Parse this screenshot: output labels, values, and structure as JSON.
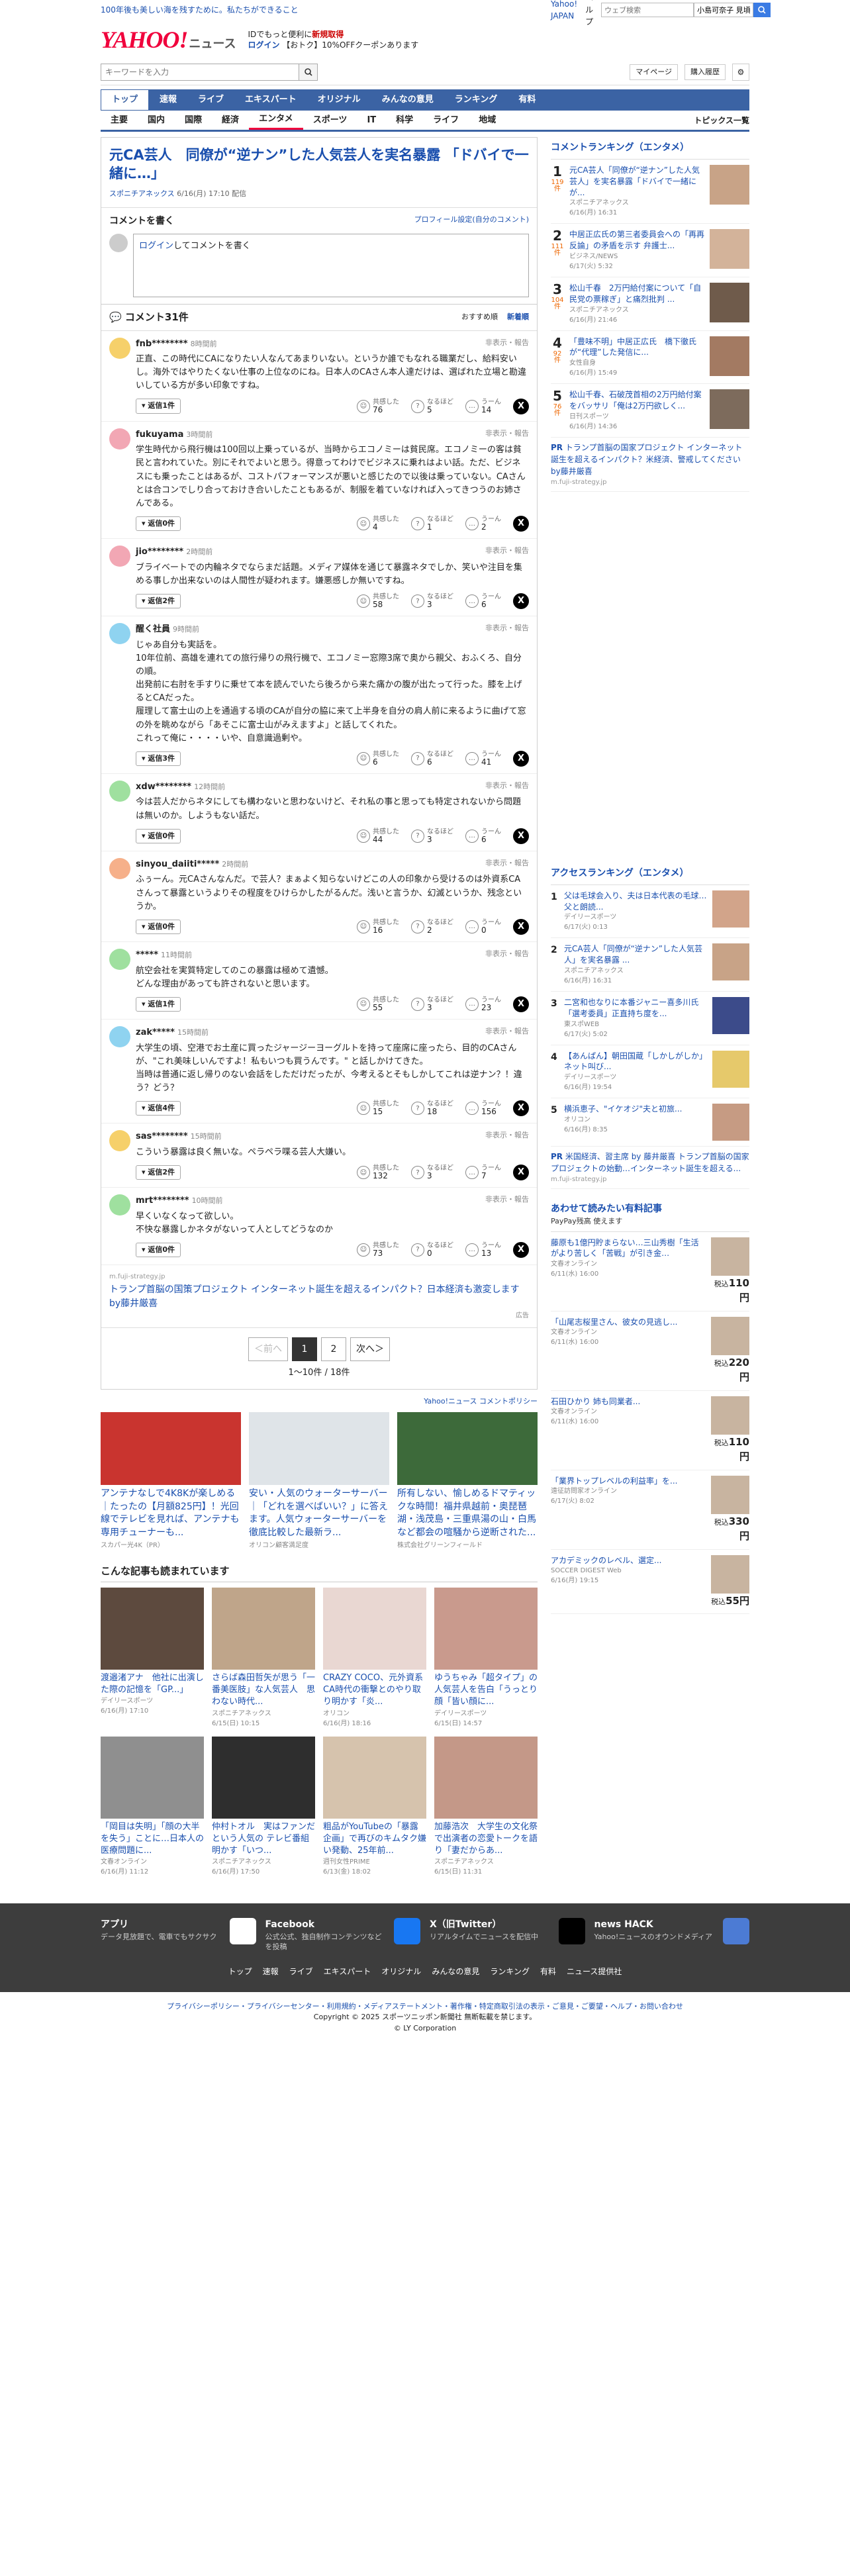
{
  "topbar": {
    "notice": "100年後も美しい海を残すために。私たちができること",
    "yahoo_japan": "Yahoo! JAPAN",
    "help": "ヘルプ",
    "search_placeholder": "ウェブ検索",
    "user": "小島可奈子 見頃"
  },
  "header": {
    "logo": "YAHOO!",
    "logo_sub": "ニュース",
    "promo1": "IDでもっと便利に",
    "promo1b": "新規取得",
    "promo2": "ログイン",
    "promo3": "【おトク】10%OFFクーポンあります"
  },
  "search": {
    "placeholder": "キーワードを入力",
    "mypage": "マイページ",
    "history": "購入履歴"
  },
  "nav": [
    "トップ",
    "速報",
    "ライブ",
    "エキスパート",
    "オリジナル",
    "みんなの意見",
    "ランキング",
    "有料"
  ],
  "subnav": [
    "主要",
    "国内",
    "国際",
    "経済",
    "エンタメ",
    "スポーツ",
    "IT",
    "科学",
    "ライフ",
    "地域"
  ],
  "subnav_right": "トピックス一覧",
  "article": {
    "title": "元CA芸人　同僚が“逆ナン”した人気芸人を実名暴露 「ドバイで一緒に…」",
    "source": "スポニチアネックス",
    "date": "6/16(月) 17:10 配信"
  },
  "comment_write": {
    "title": "コメントを書く",
    "profile": "プロフィール設定(自分のコメント)",
    "login": "ログイン",
    "placeholder": "してコメントを書く"
  },
  "comments_head": {
    "title": "コメント31件",
    "sort1": "おすすめ順",
    "sort2": "新着順"
  },
  "comments": [
    {
      "user": "fnb********",
      "time": "8時間前",
      "color": "#f6d06a",
      "text": "正直、この時代にCAになりたい人なんてあまりいない。というか誰でもなれる職業だし、給料安いし。海外ではやりたくない仕事の上位なのにね。日本人のCAさん本人達だけは、選ばれた立場と勘違いしている方が多い印象ですね。",
      "replies": "返信1件",
      "r1": "76",
      "r2": "5",
      "r3": "14"
    },
    {
      "user": "fukuyama",
      "time": "3時間前",
      "color": "#f2a7b4",
      "text": "学生時代から飛行機は100回以上乗っているが、当時からエコノミーは貧民席。エコノミーの客は貧民と言われていた。別にそれでよいと思う。得意ってわけでビジネスに乗れはよい話。ただ、ビジネスにも乗ったことはあるが、コストパフォーマンスが悪いと感じたので以後は乗っていない。CAさんとは合コンでしり合っておけき合いしたこともあるが、制服を着ていなければ入ってきつうのお姉さんである。",
      "replies": "返信0件",
      "r1": "4",
      "r2": "1",
      "r3": "2"
    },
    {
      "user": "jio********",
      "time": "2時間前",
      "color": "#f2a7b4",
      "text": "ブライベートでの内輪ネタでならまだ話題。メディア媒体を通じて暴露ネタでしか、笑いや注目を集める事しか出来ないのは人間性が疑われます。嫌悪感しか無いですね。",
      "replies": "返信2件",
      "r1": "58",
      "r2": "3",
      "r3": "6"
    },
    {
      "user": "醒く社員",
      "time": "9時間前",
      "color": "#8fd3f0",
      "text": "じゃあ自分も実話を。\n10年位前、高雄を連れての旅行帰りの飛行機で、エコノミー窓際3席で奥から親父、おふくろ、自分の順。\n出発前に右肘を手すりに乗せて本を読んでいたら後ろから来た痛かの腹が出たって行った。膝を上げるとCAだった。\n履理して富士山の上を通過する頃のCAが自分の脇に来て上半身を自分の肩人前に来るように曲げて窓の外を眺めながら「あそこに富士山がみえますよ」と話してくれた。\nこれって俺に・・・・いや、自意識過剰や。",
      "replies": "返信3件",
      "r1": "6",
      "r2": "6",
      "r3": "41"
    },
    {
      "user": "xdw********",
      "time": "12時間前",
      "color": "#9fe09f",
      "text": "今は芸人だからネタにしても構わないと思わないけど、それ私の事と思っても特定されないから問題は無いのか。しようもない話だ。",
      "replies": "返信0件",
      "r1": "44",
      "r2": "3",
      "r3": "6"
    },
    {
      "user": "sinyou_daiiti*****",
      "time": "2時間前",
      "color": "#f6b08a",
      "text": "ふぅーん。元CAさんなんだ。で芸人？まぁよく知らないけどこの人の印象から受けるのは外資系CAさんって暴露というよりその程度をひけらかしたがるんだ。浅いと言うか、幻滅というか、残念というか。",
      "replies": "返信0件",
      "r1": "16",
      "r2": "2",
      "r3": "0"
    },
    {
      "user": "*****",
      "time": "11時間前",
      "color": "#9fe09f",
      "text": "航空会社を実質特定してのこの暴露は極めて遺憾。\nどんな理由があっても許されないと思います。",
      "replies": "返信1件",
      "r1": "55",
      "r2": "3",
      "r3": "23"
    },
    {
      "user": "zak*****",
      "time": "15時間前",
      "color": "#8fd3f0",
      "text": "大学生の頃、空港でお土産に買ったジャージーヨーグルトを持って座席に座ったら、目的のCAさんが、\"これ美味しいんですよ！私もいつも買うんです。\" と話しかけてきた。\n当時は普通に返し帰りのない会話をしただけだったが、今考えるとそもしかしてこれは逆ナン？！違う？どう？",
      "replies": "返信4件",
      "r1": "15",
      "r2": "18",
      "r3": "156"
    },
    {
      "user": "sas********",
      "time": "15時間前",
      "color": "#f6d06a",
      "text": "こういう暴露は良く無いな。ペラペラ喋る芸人大嫌い。",
      "replies": "返信2件",
      "r1": "132",
      "r2": "3",
      "r3": "7"
    },
    {
      "user": "mrt********",
      "time": "10時間前",
      "color": "#9fe09f",
      "text": "早くいなくなって欲しい。\n不快な暴露しかネタがないって人としてどうなのか",
      "replies": "返信0件",
      "r1": "73",
      "r2": "0",
      "r3": "13"
    }
  ],
  "reactions": {
    "r1": "共感した",
    "r2": "なるほど",
    "r3": "うーん",
    "hide": "非表示・報告"
  },
  "inline_ad": {
    "src": "m.fuji-strategy.jp",
    "title": "トランプ首脳の国策プロジェクト インターネット誕生を超えるインパクト？日本経済も激変します by藤井厳喜",
    "note": "広告"
  },
  "pager": {
    "prev": "＜前へ",
    "p1": "1",
    "p2": "2",
    "next": "次へ＞",
    "count": "1〜10件 / 18件"
  },
  "policy": "Yahoo!ニュース コメントポリシー",
  "ad_cards": [
    {
      "title": "アンテナなしで4K8Kが楽しめる｜たったの【月額825円】！光回線でテレビを見れば、アンテナも専用チューナーも...",
      "src": "スカパー光4K（PR）",
      "img": "#c9342f"
    },
    {
      "title": "安い・人気のウォーターサーバー｜「どれを選べばいい？」に答えます。人気ウォーターサーバーを徹底比較した最新ラ...",
      "src": "オリコン顧客満足度",
      "img": "#dfe4e8"
    },
    {
      "title": "所有しない、愉しめるドマティックな時間！福井県越前・奥琵琶湖・浅茂島・三重県湯の山・白馬など都会の喧騒から逆断された...",
      "src": "株式会社グリーンフィールド",
      "img": "#3d6a3a"
    }
  ],
  "read_title": "こんな記事も読まれています",
  "read": [
    {
      "title": "渡邉渚アナ　他社に出演した際の記憶を「GP...」",
      "src": "デイリースポーツ",
      "date": "6/16(月) 17:10",
      "img": "#5d4a3e"
    },
    {
      "title": "さらば森田哲矢が思う「一番美医肢」な人気芸人　思わない時代...",
      "src": "スポニチアネックス",
      "date": "6/15(日) 10:15",
      "img": "#bfa58a"
    },
    {
      "title": "CRAZY COCO、元外資系CA時代の衝撃とのやり取り明かす「炎...",
      "src": "オリコン",
      "date": "6/16(月) 18:16",
      "img": "#e9d7d2"
    },
    {
      "title": "ゆうちゃみ「超タイプ」の人気芸人を告白「うっとり顔「皆い顔に...",
      "src": "デイリースポーツ",
      "date": "6/15(日) 14:57",
      "img": "#c99a8d"
    },
    {
      "title": "「岡目は失明」「顔の大半を失う」ことに…日本人の医療問題に...",
      "src": "文春オンライン",
      "date": "6/16(月) 11:12",
      "img": "#8f8f8f"
    },
    {
      "title": "仲村トオル　実はファンだという人気の テレビ番組明かす「いつ...",
      "src": "スポニチアネックス",
      "date": "6/16(月) 17:50",
      "img": "#2e2e2e"
    },
    {
      "title": "粗品がYouTubeの「暴露企画」で再びのキムタク嫌い発動、25年前...",
      "src": "週刊女性PRIME",
      "date": "6/13(金) 18:02",
      "img": "#d6c3ad"
    },
    {
      "title": "加藤浩次　大学生の文化祭で出演者の恋愛トークを語り「妻だからあ...",
      "src": "スポニチアネックス",
      "date": "6/15(日) 11:31",
      "img": "#c49888"
    }
  ],
  "ranking": {
    "title": "コメントランキング（エンタメ）",
    "items": [
      {
        "n": "1",
        "c": "119件",
        "title": "元CA芸人「同僚が“逆ナン”した人気芸人」を実名暴露「ドバイで一緒にが...",
        "src": "スポニチアネックス",
        "date": "6/16(月) 16:31",
        "img": "#c8a387"
      },
      {
        "n": "2",
        "c": "111件",
        "title": "中居正広氏の第三者委員会への「再再反論」の矛盾を示す 弁護士...",
        "src": "ビジネス/NEWS",
        "date": "6/17(火) 5:32",
        "img": "#d3b39a"
      },
      {
        "n": "3",
        "c": "104件",
        "title": "松山千春　2万円給付案について「自民党の票稼ぎ」と痛烈批判 ...",
        "src": "スポニチアネックス",
        "date": "6/16(月) 21:46",
        "img": "#6f5b4b"
      },
      {
        "n": "4",
        "c": "92件",
        "title": "「豊味不明」中居正広氏　橋下徹氏が“代理”した発信に...",
        "src": "女性自身",
        "date": "6/16(月) 15:49",
        "img": "#a37a62"
      },
      {
        "n": "5",
        "c": "76件",
        "title": "松山千春、石破茂首相の2万円給付案をバッサリ「俺は2万円欲しく...",
        "src": "日刊スポーツ",
        "date": "6/16(月) 14:36",
        "img": "#7d6b5c"
      }
    ],
    "pr_title": "トランプ首脳の国家プロジェクト インターネット誕生を超えるインパクト？米経済、警戒してください by藤井厳喜",
    "pr_src": "m.fuji-strategy.jp"
  },
  "access": {
    "title": "アクセスランキング（エンタメ）",
    "items": [
      {
        "n": "1",
        "title": "父は毛球会入り、夫は日本代表の毛球…父と朗読...",
        "src": "デイリースポーツ",
        "date": "6/17(火) 0:13",
        "img": "#d2a48a"
      },
      {
        "n": "2",
        "title": "元CA芸人「同僚が“逆ナン”した人気芸人」を実名暴露 ...",
        "src": "スポニチアネックス",
        "date": "6/16(月) 16:31",
        "img": "#c8a387"
      },
      {
        "n": "3",
        "title": "二宮和也なりに本番ジャニー喜多川氏「選考委員」正直持ち度を...",
        "src": "東スポWEB",
        "date": "6/17(火) 5:02",
        "img": "#3c4b8a"
      },
      {
        "n": "4",
        "title": "【あんぱん】朝田国蔵「しかしがしか」 ネット叫び...",
        "src": "デイリースポーツ",
        "date": "6/16(月) 19:54",
        "img": "#e6c96b"
      },
      {
        "n": "5",
        "title": "横浜恵子、\"イケオジ\"夫と初旅...",
        "src": "オリコン",
        "date": "6/16(月) 8:35",
        "img": "#c69b83"
      }
    ],
    "pr_title": "米国経済、習主席 by 藤井厳喜 トランプ首脳の国家プロジェクトの始動…インターネット誕生を超える...",
    "pr_src": "m.fuji-strategy.jp"
  },
  "shop": {
    "title": "あわせて読みたい有料記事",
    "sub": "PayPay残高 使えます",
    "items": [
      {
        "title": "藤原も1億円貯まらない…三山秀樹「生活がより苦しく「苦戦」が引き金…",
        "src": "文春オンライン",
        "date": "6/11(水) 16:00",
        "price": "110"
      },
      {
        "title": "「山尾志桜里さん、彼女の見逃し...",
        "src": "文春オンライン",
        "date": "6/11(水) 16:00",
        "price": "220"
      },
      {
        "title": "石田ひかり 姉も同業者...",
        "src": "文春オンライン",
        "date": "6/11(水) 16:00",
        "price": "110"
      },
      {
        "title": "「業界トップレベルの利益率」を...",
        "src": "遠征訪問家オンライン",
        "date": "6/17(火) 8:02",
        "price": "330"
      },
      {
        "title": "アカデミックのレベル、選定...",
        "src": "SOCCER DIGEST Web",
        "date": "6/16(月) 19:15",
        "price": "55"
      }
    ]
  },
  "footer": {
    "apps": [
      {
        "name": "アプリ",
        "desc": "データ見放題で、電車でもサクサク",
        "color": "#fff"
      },
      {
        "name": "Facebook",
        "desc": "公式公式、独自制作コンテンツなどを投稿",
        "color": "#1877f2"
      },
      {
        "name": "X（旧Twitter）",
        "desc": "リアルタイムでニュースを配信中",
        "color": "#000"
      },
      {
        "name": "news HACK",
        "desc": "Yahoo!ニュースのオウンドメディア",
        "color": "#4c7bd4"
      }
    ],
    "links": [
      "トップ",
      "速報",
      "ライブ",
      "エキスパート",
      "オリジナル",
      "みんなの意見",
      "ランキング",
      "有料",
      "ニュース提供社"
    ],
    "policies": "プライバシーポリシー・プライバシーセンター・利用規約・メディアステートメント・著作権・特定商取引法の表示・ご意見・ご要望・ヘルプ・お問い合わせ",
    "copy1": "Copyright © 2025 スポーツニッポン新聞社 無断転載を禁じます。",
    "copy2": "© LY Corporation"
  }
}
